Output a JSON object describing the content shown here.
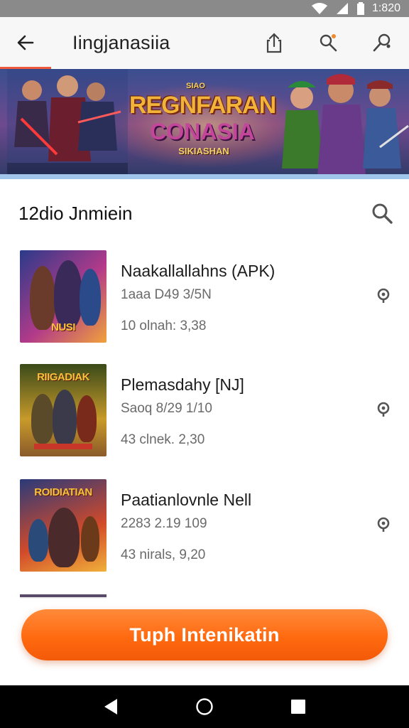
{
  "status_bar": {
    "time": "1:820"
  },
  "app_bar": {
    "title": "Iingjanasiia"
  },
  "banner": {
    "title_line1": "REGNFARAN",
    "title_line2": "CONASIA",
    "tagline": "SIKIASHAN",
    "badge": "SIAO"
  },
  "section": {
    "title": "12dio Jnmiein"
  },
  "apps": [
    {
      "name": "Naakallallahns (APK)",
      "meta": "1aaa D49 3/5N",
      "stats": "10 olnah:  3,38",
      "thumb_text": "NUSI",
      "thumb_colors": [
        "#2a3a8a",
        "#b23a8a",
        "#f0a23a"
      ]
    },
    {
      "name": "Plemasdahy [NJ]",
      "meta": "Saoq 8/29 1/10",
      "stats": "43 clnek.  2,30",
      "thumb_text": "RIIGADIAK",
      "thumb_colors": [
        "#3a4a1a",
        "#c89a2a",
        "#8a5a2a"
      ]
    },
    {
      "name": "Paatianlovnle Nell",
      "meta": "2283 2.19 109",
      "stats": "43 nirals,  9,20",
      "thumb_text": "ROIDIATIAN",
      "thumb_colors": [
        "#2a3a7a",
        "#d24a2a",
        "#f0b03a"
      ]
    }
  ],
  "cta": {
    "label": "Tuph Intenikatin"
  },
  "colors": {
    "accent": "#ff6a10",
    "status_bar": "#8a8a8a",
    "nav_bar": "#000000"
  }
}
